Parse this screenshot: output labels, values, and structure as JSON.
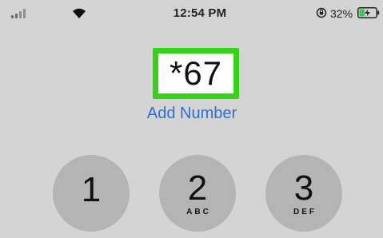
{
  "status_bar": {
    "time": "12:54 PM",
    "battery_percent": "32%",
    "signal_bars_active": 2,
    "battery_level": 0.32
  },
  "dialer": {
    "entered_number": "*67",
    "add_number_label": "Add Number"
  },
  "keypad": [
    {
      "digit": "1",
      "letters": ""
    },
    {
      "digit": "2",
      "letters": "ABC"
    },
    {
      "digit": "3",
      "letters": "DEF"
    }
  ],
  "colors": {
    "highlight": "#34d219",
    "link": "#2b6fd3",
    "background": "#d4d4d4",
    "key": "#b4b4b4",
    "battery": "#34c759"
  }
}
